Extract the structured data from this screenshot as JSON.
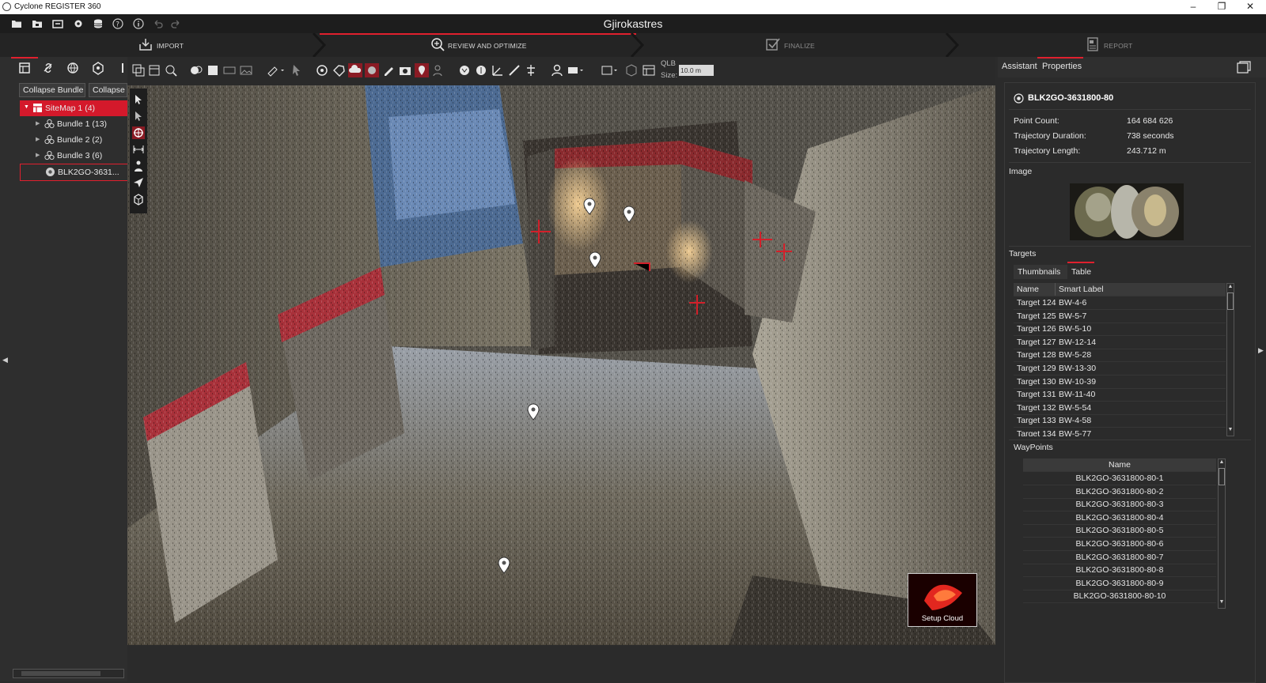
{
  "window": {
    "app_title": "Cyclone REGISTER 360",
    "controls": [
      "–",
      "❐",
      "✕"
    ]
  },
  "project": {
    "title": "Gjirokastres"
  },
  "workflow": {
    "steps": [
      {
        "label": "IMPORT",
        "state": "done"
      },
      {
        "label": "REVIEW AND OPTIMIZE",
        "state": "active"
      },
      {
        "label": "FINALIZE",
        "state": "inactive"
      },
      {
        "label": "REPORT",
        "state": "inactive"
      }
    ]
  },
  "menu": {
    "icons": [
      "open-folder-icon",
      "save-icon",
      "import-icon",
      "settings-gear-icon",
      "database-icon",
      "help-icon",
      "info-icon",
      "undo-icon",
      "redo-icon"
    ]
  },
  "left_panel": {
    "buttons": {
      "collapse_bundle": "Collapse Bundle",
      "collapse_all": "Collapse"
    },
    "tree": [
      {
        "label": "SiteMap 1 (4)",
        "level": 0,
        "expanded": true,
        "selected": true,
        "icon": "sitemap-icon"
      },
      {
        "label": "Bundle 1 (13)",
        "level": 1,
        "expanded": false,
        "icon": "bundle-icon"
      },
      {
        "label": "Bundle 2 (2)",
        "level": 1,
        "expanded": false,
        "icon": "bundle-icon"
      },
      {
        "label": "Bundle 3 (6)",
        "level": 1,
        "expanded": false,
        "icon": "bundle-icon"
      },
      {
        "label": "BLK2GO-3631...",
        "level": 1,
        "expanded": null,
        "highlighted": true,
        "icon": "setup-icon"
      }
    ]
  },
  "viewer_toolbar": {
    "qlb_label": "QLB",
    "size_label": "Size:",
    "size_value": "10.0 m"
  },
  "viewport": {
    "setup_cloud_label": "Setup Cloud"
  },
  "right_panel": {
    "tabs": [
      "Assistant",
      "Properties"
    ],
    "active_tab": "Properties",
    "setup_name": "BLK2GO-3631800-80",
    "properties": [
      {
        "label": "Point Count:",
        "value": "164 684 626"
      },
      {
        "label": "Trajectory Duration:",
        "value": "738 seconds"
      },
      {
        "label": "Trajectory Length:",
        "value": "243.712 m"
      }
    ],
    "image_heading": "Image",
    "targets_heading": "Targets",
    "targets_tabs": [
      "Thumbnails",
      "Table"
    ],
    "targets_active_tab": "Table",
    "targets_columns": [
      "Name",
      "Smart Label"
    ],
    "targets_rows": [
      [
        "Target 124",
        "BW-4-6"
      ],
      [
        "Target 125",
        "BW-5-7"
      ],
      [
        "Target 126",
        "BW-5-10"
      ],
      [
        "Target 127",
        "BW-12-14"
      ],
      [
        "Target 128",
        "BW-5-28"
      ],
      [
        "Target 129",
        "BW-13-30"
      ],
      [
        "Target 130",
        "BW-10-39"
      ],
      [
        "Target 131",
        "BW-11-40"
      ],
      [
        "Target 132",
        "BW-5-54"
      ],
      [
        "Target 133",
        "BW-4-58"
      ],
      [
        "Target 134",
        "BW-5-77"
      ]
    ],
    "waypoints_heading": "WayPoints",
    "waypoints_column": "Name",
    "waypoints": [
      "BLK2GO-3631800-80-1",
      "BLK2GO-3631800-80-2",
      "BLK2GO-3631800-80-3",
      "BLK2GO-3631800-80-4",
      "BLK2GO-3631800-80-5",
      "BLK2GO-3631800-80-6",
      "BLK2GO-3631800-80-7",
      "BLK2GO-3631800-80-8",
      "BLK2GO-3631800-80-9",
      "BLK2GO-3631800-80-10"
    ]
  },
  "colors": {
    "accent_red": "#e0202e",
    "selected_red": "#d4192b",
    "panel_bg": "#2b2b2b"
  }
}
